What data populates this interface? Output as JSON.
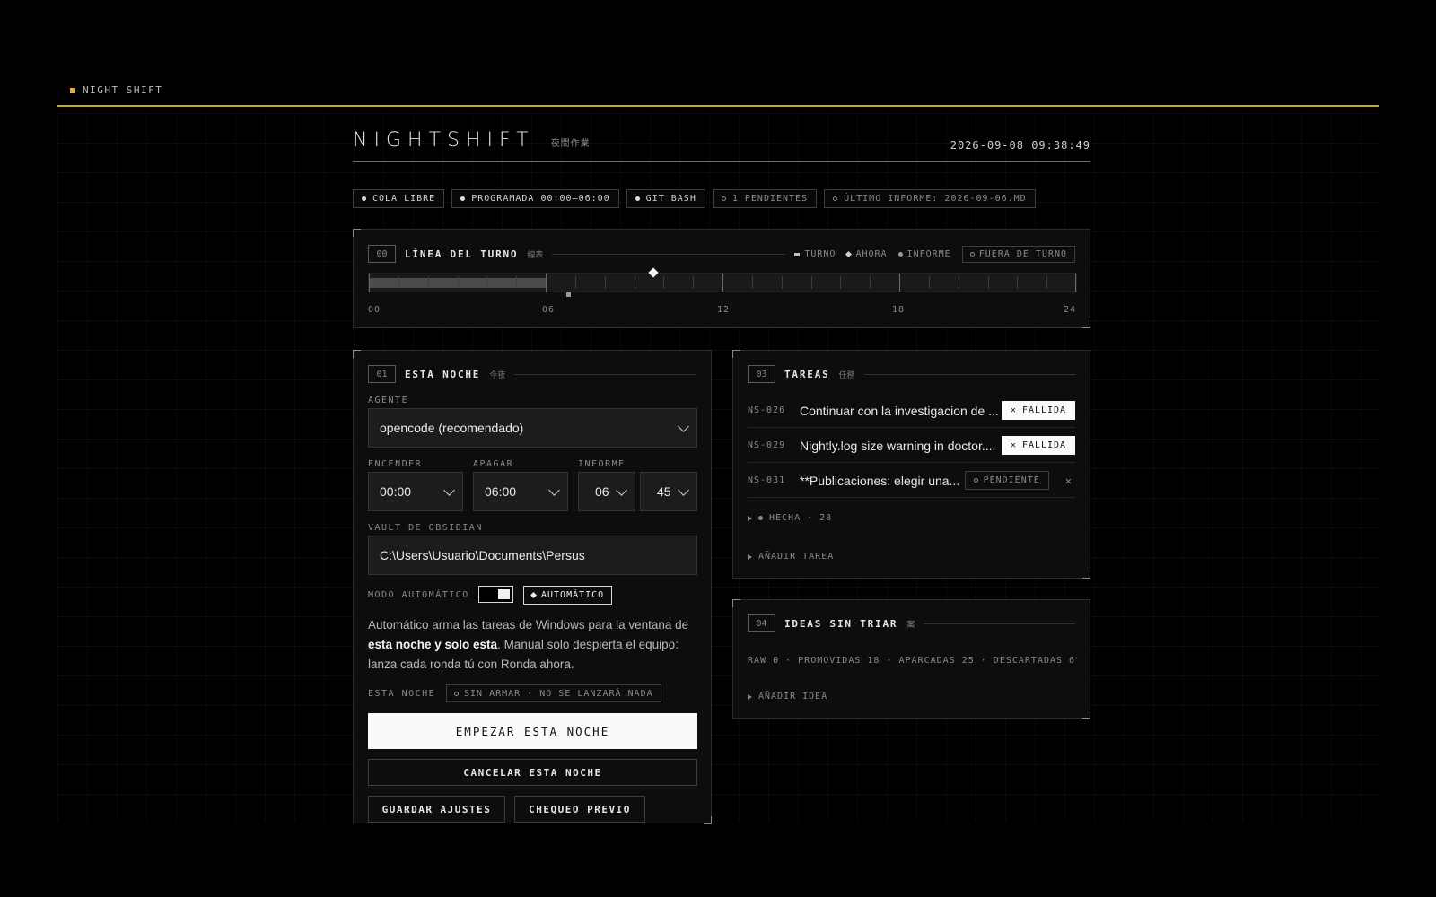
{
  "window": {
    "title": "NIGHT SHIFT"
  },
  "header": {
    "brand": "NIGHTSHIFT",
    "brand_kanji": "夜間作業",
    "clock": "2026-09-08 09:38:49"
  },
  "status_chips": [
    {
      "label": "COLA LIBRE",
      "icon": "filled-dot"
    },
    {
      "label": "PROGRAMADA 00:00–06:00",
      "icon": "filled-dot"
    },
    {
      "label": "GIT BASH",
      "icon": "filled-dot"
    },
    {
      "label": "1 PENDIENTES",
      "icon": "hollow-dot"
    },
    {
      "label": "ÚLTIMO INFORME: 2026-09-06.MD",
      "icon": "hollow-dot"
    }
  ],
  "timeline": {
    "num": "00",
    "title": "LÍNEA DEL TURNO",
    "kanji": "線表",
    "legend": {
      "turno": "TURNO",
      "ahora": "AHORA",
      "informe": "INFORME",
      "fuera": "FUERA DE TURNO"
    },
    "axis": [
      "00",
      "06",
      "12",
      "18",
      "24"
    ],
    "shift_start_h": 0,
    "shift_end_h": 6,
    "now_h": 9.65,
    "report_h": 6.75
  },
  "tonight": {
    "num": "01",
    "title": "ESTA NOCHE",
    "kanji": "今夜",
    "agent_label": "AGENTE",
    "agent_value": "opencode (recomendado)",
    "on_label": "ENCENDER",
    "on_value": "00:00",
    "off_label": "APAGAR",
    "off_value": "06:00",
    "report_label": "INFORME",
    "report_hour": "06",
    "report_min": "45",
    "vault_label": "VAULT DE OBSIDIAN",
    "vault_value": "C:\\Users\\Usuario\\Documents\\Persus",
    "mode_label": "MODO AUTOMÁTICO",
    "mode_badge": "AUTOMÁTICO",
    "mode_on": true,
    "desc_1": "Automático arma las tareas de Windows para la ventana de ",
    "desc_bold": "esta noche y solo esta",
    "desc_2": ". Manual solo despierta el equipo: lanza cada ronda tú con Ronda ahora.",
    "status_label": "ESTA NOCHE",
    "status_value": "SIN ARMAR · NO SE LANZARÁ NADA",
    "btn_start": "EMPEZAR ESTA NOCHE",
    "btn_cancel": "CANCELAR ESTA NOCHE",
    "btn_save": "GUARDAR AJUSTES",
    "btn_check": "CHEQUEO PREVIO"
  },
  "tasks": {
    "num": "03",
    "title": "TAREAS",
    "kanji": "任務",
    "items": [
      {
        "id": "NS-026",
        "title": "Continuar con la investigacion de ...",
        "status": "FALLIDA"
      },
      {
        "id": "NS-029",
        "title": "Nightly.log size warning in doctor....",
        "status": "FALLIDA"
      },
      {
        "id": "NS-031",
        "title": "**Publicaciones: elegir una...",
        "status": "PENDIENTE"
      }
    ],
    "done_label": "HECHA",
    "done_count": "28",
    "add_label": "AÑADIR TAREA"
  },
  "ideas": {
    "num": "04",
    "title": "IDEAS SIN TRIAR",
    "kanji": "案",
    "summary": "RAW 0 · PROMOVIDAS 18 · APARCADAS 25 · DESCARTADAS 6",
    "add_label": "AÑADIR IDEA"
  },
  "colors": {
    "accent": "#c9a24a",
    "title_square": "#e2b23c",
    "panel_bg": "#0d0d0d",
    "field_bg": "#1c1c1c"
  }
}
